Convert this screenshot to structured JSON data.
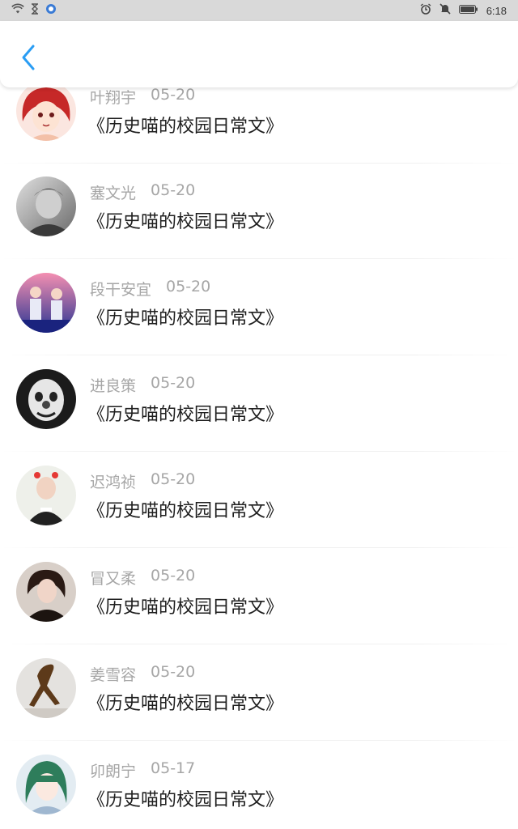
{
  "status_bar": {
    "time": "6:18"
  },
  "app_bar": {
    "back_icon": "chevron-left-icon",
    "accent_color": "#2a9df4"
  },
  "list": {
    "items": [
      {
        "name": "叶翔宇",
        "date": "05-20",
        "title": "《历史喵的校园日常文》",
        "avatar": "anime-girl-red-hair"
      },
      {
        "name": "塞文光",
        "date": "05-20",
        "title": "《历史喵的校园日常文》",
        "avatar": "grayscale-photo-boy"
      },
      {
        "name": "段干安宜",
        "date": "05-20",
        "title": "《历史喵的校园日常文》",
        "avatar": "two-boys-dusk"
      },
      {
        "name": "进良策",
        "date": "05-20",
        "title": "《历史喵的校园日常文》",
        "avatar": "clown-bw"
      },
      {
        "name": "迟鸿祯",
        "date": "05-20",
        "title": "《历史喵的校园日常文》",
        "avatar": "boy-black-tshirt"
      },
      {
        "name": "冒又柔",
        "date": "05-20",
        "title": "《历史喵的校园日常文》",
        "avatar": "doll-dark"
      },
      {
        "name": "姜雪容",
        "date": "05-20",
        "title": "《历史喵的校园日常文》",
        "avatar": "sculpture"
      },
      {
        "name": "卯朗宁",
        "date": "05-17",
        "title": "《历史喵的校园日常文》",
        "avatar": "anime-green-hair"
      }
    ]
  }
}
